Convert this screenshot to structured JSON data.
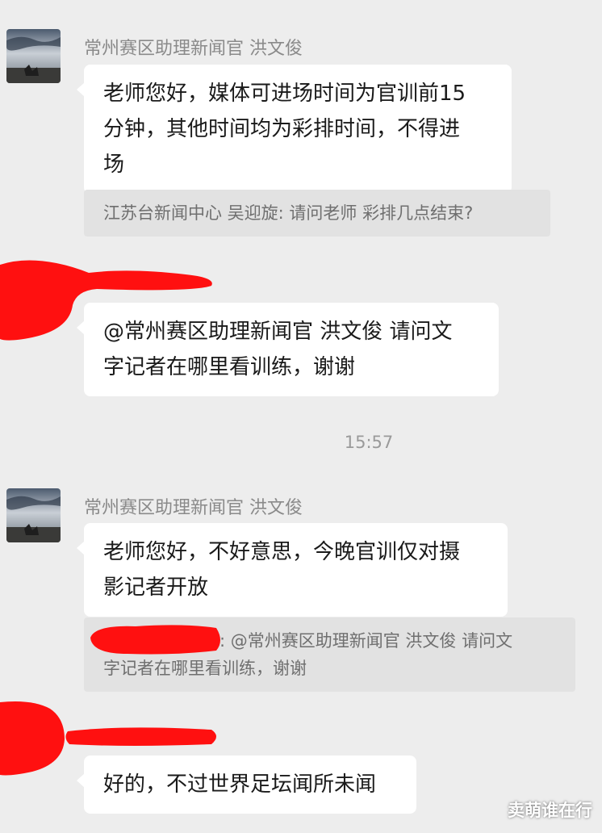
{
  "chat": {
    "messages": [
      {
        "sender": "常州赛区助理新闻官 洪文俊",
        "text_lines": [
          "老师您好，媒体可进场时间为官训前15",
          "分钟，其他时间均为彩排时间，不得进",
          "场"
        ],
        "quote": "江苏台新闻中心 吴迎旋: 请问老师 彩排几点结束?"
      },
      {
        "sender": "",
        "text_lines": [
          "@常州赛区助理新闻官 洪文俊 请问文",
          "字记者在哪里看训练，谢谢"
        ]
      },
      {
        "sender": "常州赛区助理新闻官 洪文俊",
        "text_lines": [
          "老师您好，不好意思，今晚官训仅对摄",
          "影记者开放"
        ],
        "quote_lines": [
          ": @常州赛区助理新闻官 洪文俊 请问文",
          "字记者在哪里看训练，谢谢"
        ]
      },
      {
        "sender": "",
        "text_lines": [
          "好的，不过世界足坛闻所未闻"
        ]
      }
    ],
    "timestamp": "15:57"
  },
  "watermark": "卖萌谁在行",
  "colors": {
    "background": "#ededed",
    "bubble": "#ffffff",
    "quote_bg": "#e2e2e2",
    "redaction": "#ff1010"
  }
}
